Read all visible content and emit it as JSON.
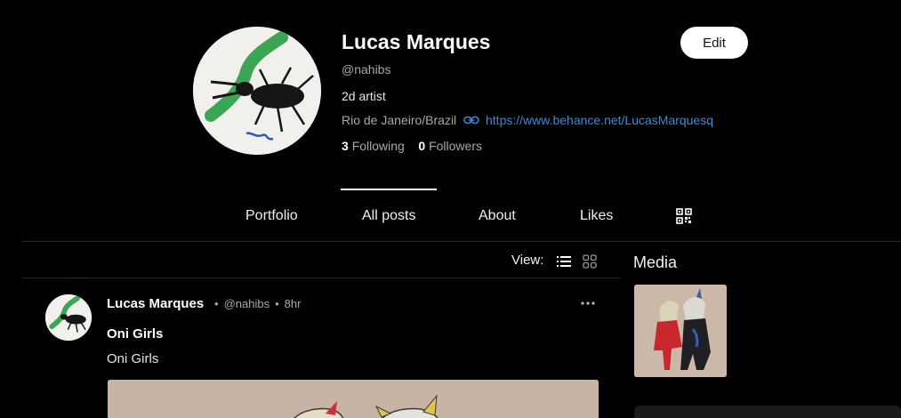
{
  "profile": {
    "name": "Lucas Marques",
    "handle": "@nahibs",
    "bio": "2d artist",
    "location": "Rio de Janeiro/Brazil",
    "link": "https://www.behance.net/LucasMarquesq",
    "following_count": "3",
    "following_label": "Following",
    "followers_count": "0",
    "followers_label": "Followers",
    "edit_label": "Edit"
  },
  "tabs": [
    {
      "label": "Portfolio"
    },
    {
      "label": "All posts",
      "active": true
    },
    {
      "label": "About"
    },
    {
      "label": "Likes"
    }
  ],
  "icons": {
    "link": "link-icon",
    "qr": "qr-code-icon",
    "list_view": "list-view-icon",
    "grid_view": "grid-view-icon",
    "more": "more-options-icon"
  },
  "feed": {
    "view_label": "View:",
    "post": {
      "author": "Lucas Marques",
      "handle": "@nahibs",
      "time": "8hr",
      "title": "Oni Girls",
      "body": "Oni Girls"
    }
  },
  "sidebar": {
    "media_heading": "Media"
  },
  "colors": {
    "background": "#000000",
    "link": "#3b8ad9",
    "muted_text": "#a8a8a8",
    "divider": "#2a2a2a"
  }
}
